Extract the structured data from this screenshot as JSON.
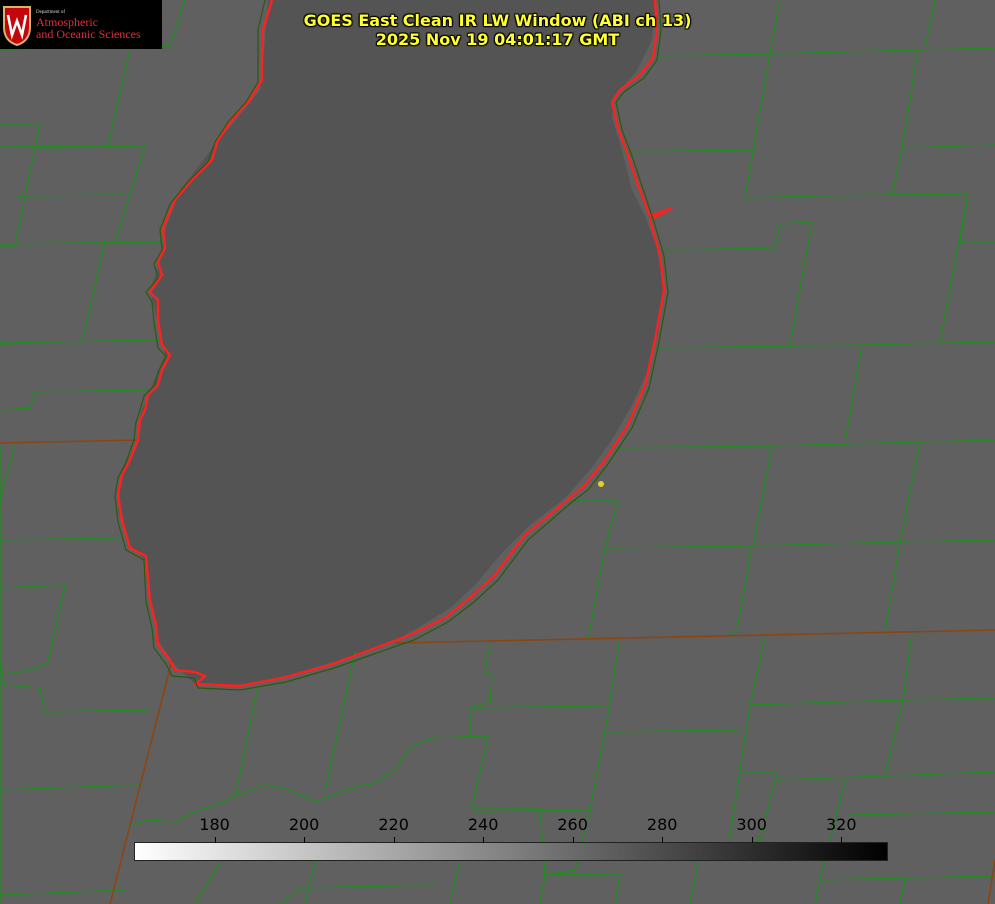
{
  "title": {
    "line1": "GOES East Clean IR LW Window (ABI ch 13)",
    "line2": "2025 Nov 19 04:01:17 GMT"
  },
  "logo": {
    "department": "Department of",
    "line1": "Atmospheric",
    "line2": "and Oceanic Sciences"
  },
  "colorbar": {
    "ticks": [
      "180",
      "200",
      "220",
      "240",
      "260",
      "280",
      "300",
      "320"
    ],
    "tick_values": [
      180,
      200,
      220,
      240,
      260,
      280,
      300,
      320
    ],
    "range": [
      162,
      330
    ],
    "gradient": [
      "#ffffff",
      "#000000"
    ]
  },
  "colors": {
    "background": "#606060",
    "lake_fill": "#525252",
    "county_lines": "#1a8a1a",
    "state_lines": "#8b4513",
    "coastline": "#ff2020",
    "title": "#ffff33",
    "marker": "#e6d21e"
  }
}
